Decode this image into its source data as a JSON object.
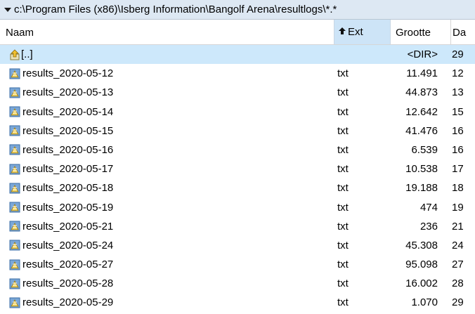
{
  "path": "c:\\Program Files (x86)\\Isberg Information\\Bangolf Arena\\resultlogs\\*.*",
  "columns": {
    "name": "Naam",
    "ext": "Ext",
    "size": "Grootte",
    "date": "Da"
  },
  "parent_row": {
    "name": "[..]",
    "size": "<DIR>",
    "date": "29"
  },
  "files": [
    {
      "name": "results_2020-05-12",
      "ext": "txt",
      "size": "11.491",
      "date": "12"
    },
    {
      "name": "results_2020-05-13",
      "ext": "txt",
      "size": "44.873",
      "date": "13"
    },
    {
      "name": "results_2020-05-14",
      "ext": "txt",
      "size": "12.642",
      "date": "15"
    },
    {
      "name": "results_2020-05-15",
      "ext": "txt",
      "size": "41.476",
      "date": "16"
    },
    {
      "name": "results_2020-05-16",
      "ext": "txt",
      "size": "6.539",
      "date": "16"
    },
    {
      "name": "results_2020-05-17",
      "ext": "txt",
      "size": "10.538",
      "date": "17"
    },
    {
      "name": "results_2020-05-18",
      "ext": "txt",
      "size": "19.188",
      "date": "18"
    },
    {
      "name": "results_2020-05-19",
      "ext": "txt",
      "size": "474",
      "date": "19"
    },
    {
      "name": "results_2020-05-21",
      "ext": "txt",
      "size": "236",
      "date": "21"
    },
    {
      "name": "results_2020-05-24",
      "ext": "txt",
      "size": "45.308",
      "date": "24"
    },
    {
      "name": "results_2020-05-27",
      "ext": "txt",
      "size": "95.098",
      "date": "27"
    },
    {
      "name": "results_2020-05-28",
      "ext": "txt",
      "size": "16.002",
      "date": "28"
    },
    {
      "name": "results_2020-05-29",
      "ext": "txt",
      "size": "1.070",
      "date": "29"
    }
  ],
  "icons": {
    "path_dropdown": "chevron-down-icon",
    "sort": "arrow-up-icon",
    "parent": "folder-up-icon",
    "file": "text-file-icon"
  },
  "colors": {
    "path_bar_bg": "#dde8f3",
    "selected_row_bg": "#cde8fb",
    "sorted_header_bg": "#cde4f7"
  }
}
